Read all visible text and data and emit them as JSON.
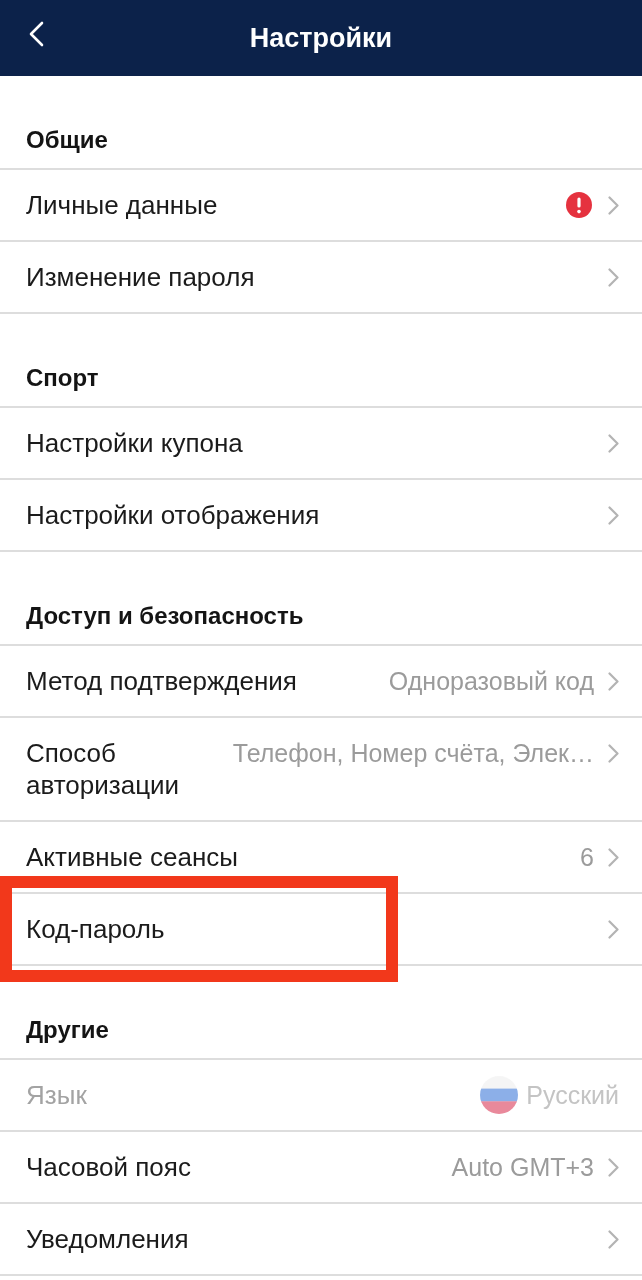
{
  "header": {
    "title": "Настройки"
  },
  "sections": [
    {
      "title": "Общие",
      "items": [
        {
          "kind": "link",
          "label": "Личные данные",
          "alert": true,
          "disabled": false,
          "highlighted": false
        },
        {
          "kind": "link",
          "label": "Изменение пароля",
          "alert": false,
          "disabled": false,
          "highlighted": false
        }
      ]
    },
    {
      "title": "Спорт",
      "items": [
        {
          "kind": "link",
          "label": "Настройки купона",
          "alert": false,
          "disabled": false,
          "highlighted": false
        },
        {
          "kind": "link",
          "label": "Настройки отображения",
          "alert": false,
          "disabled": false,
          "highlighted": false
        }
      ]
    },
    {
      "title": "Доступ и безопасность",
      "items": [
        {
          "kind": "link",
          "label": "Метод подтверждения",
          "value": "Одноразовый код",
          "alert": false,
          "disabled": false,
          "highlighted": false
        },
        {
          "kind": "link",
          "label": "Способ авторизации",
          "value": "Телефон, Номер счёта, Элек…",
          "alert": false,
          "disabled": false,
          "highlighted": false
        },
        {
          "kind": "link",
          "label": "Активные сеансы",
          "value": "6",
          "alert": false,
          "disabled": false,
          "highlighted": false
        },
        {
          "kind": "link",
          "label": "Код-пароль",
          "alert": false,
          "disabled": false,
          "highlighted": true
        }
      ]
    },
    {
      "title": "Другие",
      "items": [
        {
          "kind": "language",
          "label": "Язык",
          "value": "Русский",
          "alert": false,
          "disabled": true,
          "highlighted": false
        },
        {
          "kind": "link",
          "label": "Часовой пояс",
          "value": "Auto GMT+3",
          "alert": false,
          "disabled": false,
          "highlighted": false
        },
        {
          "kind": "link",
          "label": "Уведомления",
          "alert": false,
          "disabled": false,
          "highlighted": false
        }
      ]
    }
  ]
}
